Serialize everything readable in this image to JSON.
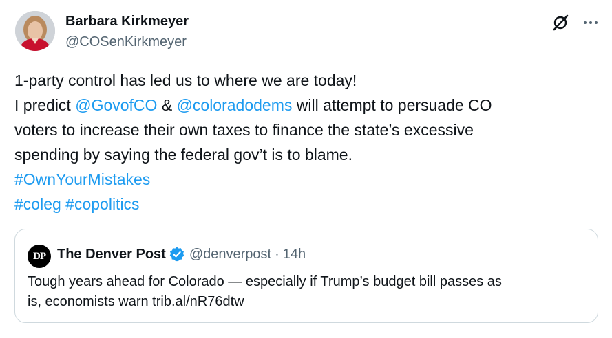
{
  "author": {
    "name": "Barbara Kirkmeyer",
    "handle": "@COSenKirkmeyer"
  },
  "actions": {
    "grok_icon": "grok-icon",
    "more_icon": "more-options-icon"
  },
  "tweet": {
    "line1": "1-party control has led us to where we are today!",
    "line2_pre": "I predict ",
    "mention1": "@GovofCO",
    "line2_amp": " & ",
    "mention2": "@coloradodems",
    "line2_post": " will attempt to persuade CO",
    "line3": "voters to increase their own taxes to finance the state’s excessive",
    "line4": "spending by saying the federal gov’t is to blame.",
    "hashtag1": "#OwnYourMistakes",
    "hashtag2": "#coleg",
    "hashtag3": "#copolitics"
  },
  "quote": {
    "logo_text": "DP",
    "name": "The Denver Post",
    "handle": "@denverpost",
    "separator": "·",
    "time": "14h",
    "text_line1": "Tough years ahead for Colorado — especially if Trump’s budget bill passes as",
    "text_line2_pre": "is, economists warn ",
    "text_link": "trib.al/nR76dtw"
  },
  "colors": {
    "link": "#1d9bf0",
    "text": "#0f1419",
    "secondary": "#536471",
    "border": "#cfd9de"
  }
}
